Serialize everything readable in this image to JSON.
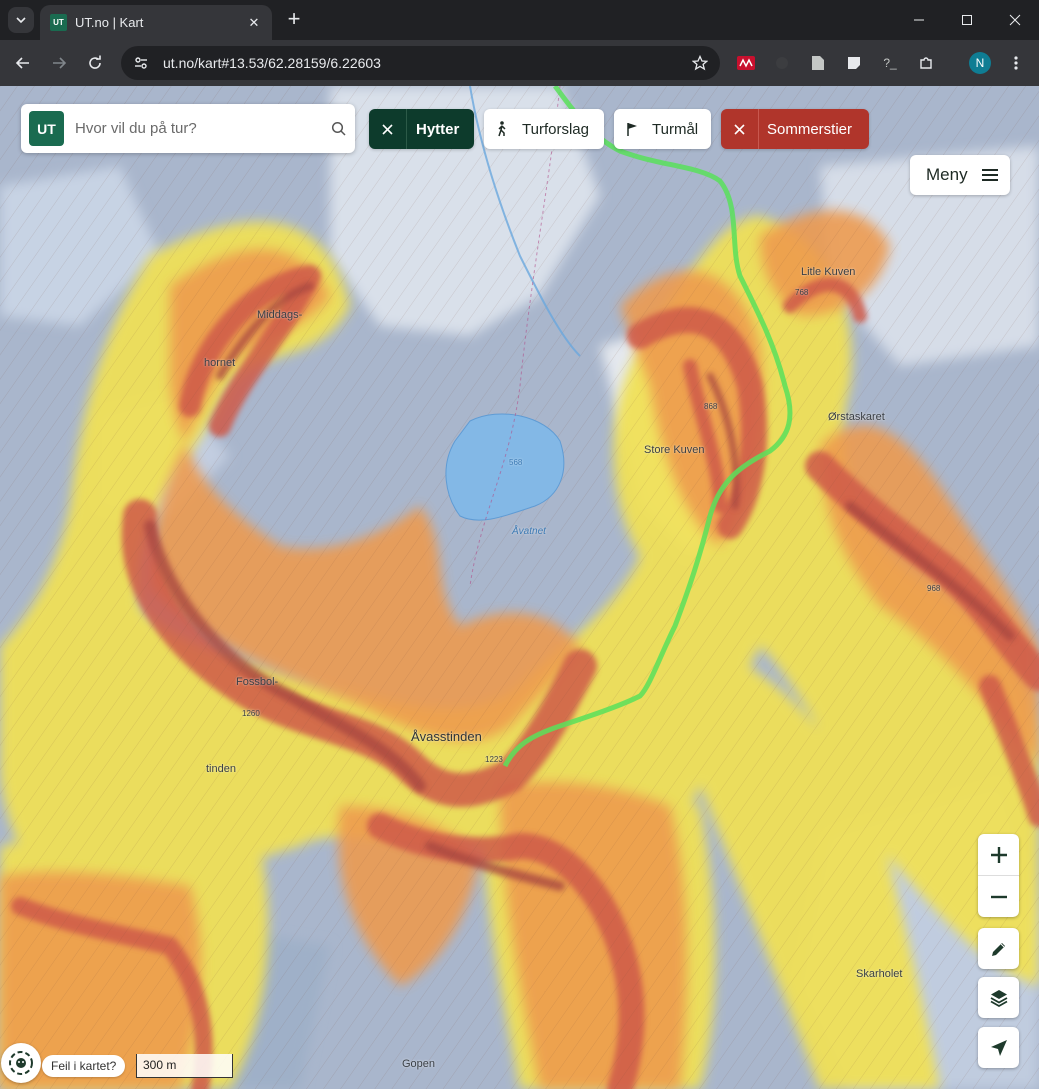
{
  "browser": {
    "tab_title": "UT.no | Kart",
    "favicon_text": "UT",
    "url": "ut.no/kart#13.53/62.28159/6.22603",
    "profile_initial": "N",
    "icons": {
      "tab_search": "chevron-down-icon",
      "back": "arrow-left-icon",
      "forward": "arrow-right-icon",
      "reload": "reload-icon",
      "site_info": "tune-icon",
      "bookmark": "star-icon"
    }
  },
  "app": {
    "logo_text": "UT",
    "search_placeholder": "Hvor vil du på tur?",
    "filters": [
      {
        "label": "Hytter",
        "active": true
      },
      {
        "label": "Turforslag",
        "active": false
      },
      {
        "label": "Turmål",
        "active": false
      },
      {
        "label": "Sommerstier",
        "active": true
      }
    ],
    "menu_label": "Meny",
    "report_error_label": "Feil i kartet?",
    "scale_label": "300 m",
    "colors": {
      "brand": "#1a6b50",
      "hytter_active": "#0d3b2c",
      "sommerstier_active": "#b0352b",
      "trail": "#59e05a"
    }
  },
  "map": {
    "labels": [
      {
        "text": "Middags-"
      },
      {
        "text": "hornet"
      },
      {
        "text": "Litle Kuven"
      },
      {
        "text": "768"
      },
      {
        "text": "868"
      },
      {
        "text": "Ørstaskaret"
      },
      {
        "text": "Store Kuven"
      },
      {
        "text": "568"
      },
      {
        "text": "Åvatnet"
      },
      {
        "text": "Fossbol-"
      },
      {
        "text": "1260"
      },
      {
        "text": "tinden"
      },
      {
        "text": "Åvasstinden"
      },
      {
        "text": "1223"
      },
      {
        "text": "968"
      },
      {
        "text": "Skarholet"
      },
      {
        "text": "Gopen"
      }
    ]
  }
}
